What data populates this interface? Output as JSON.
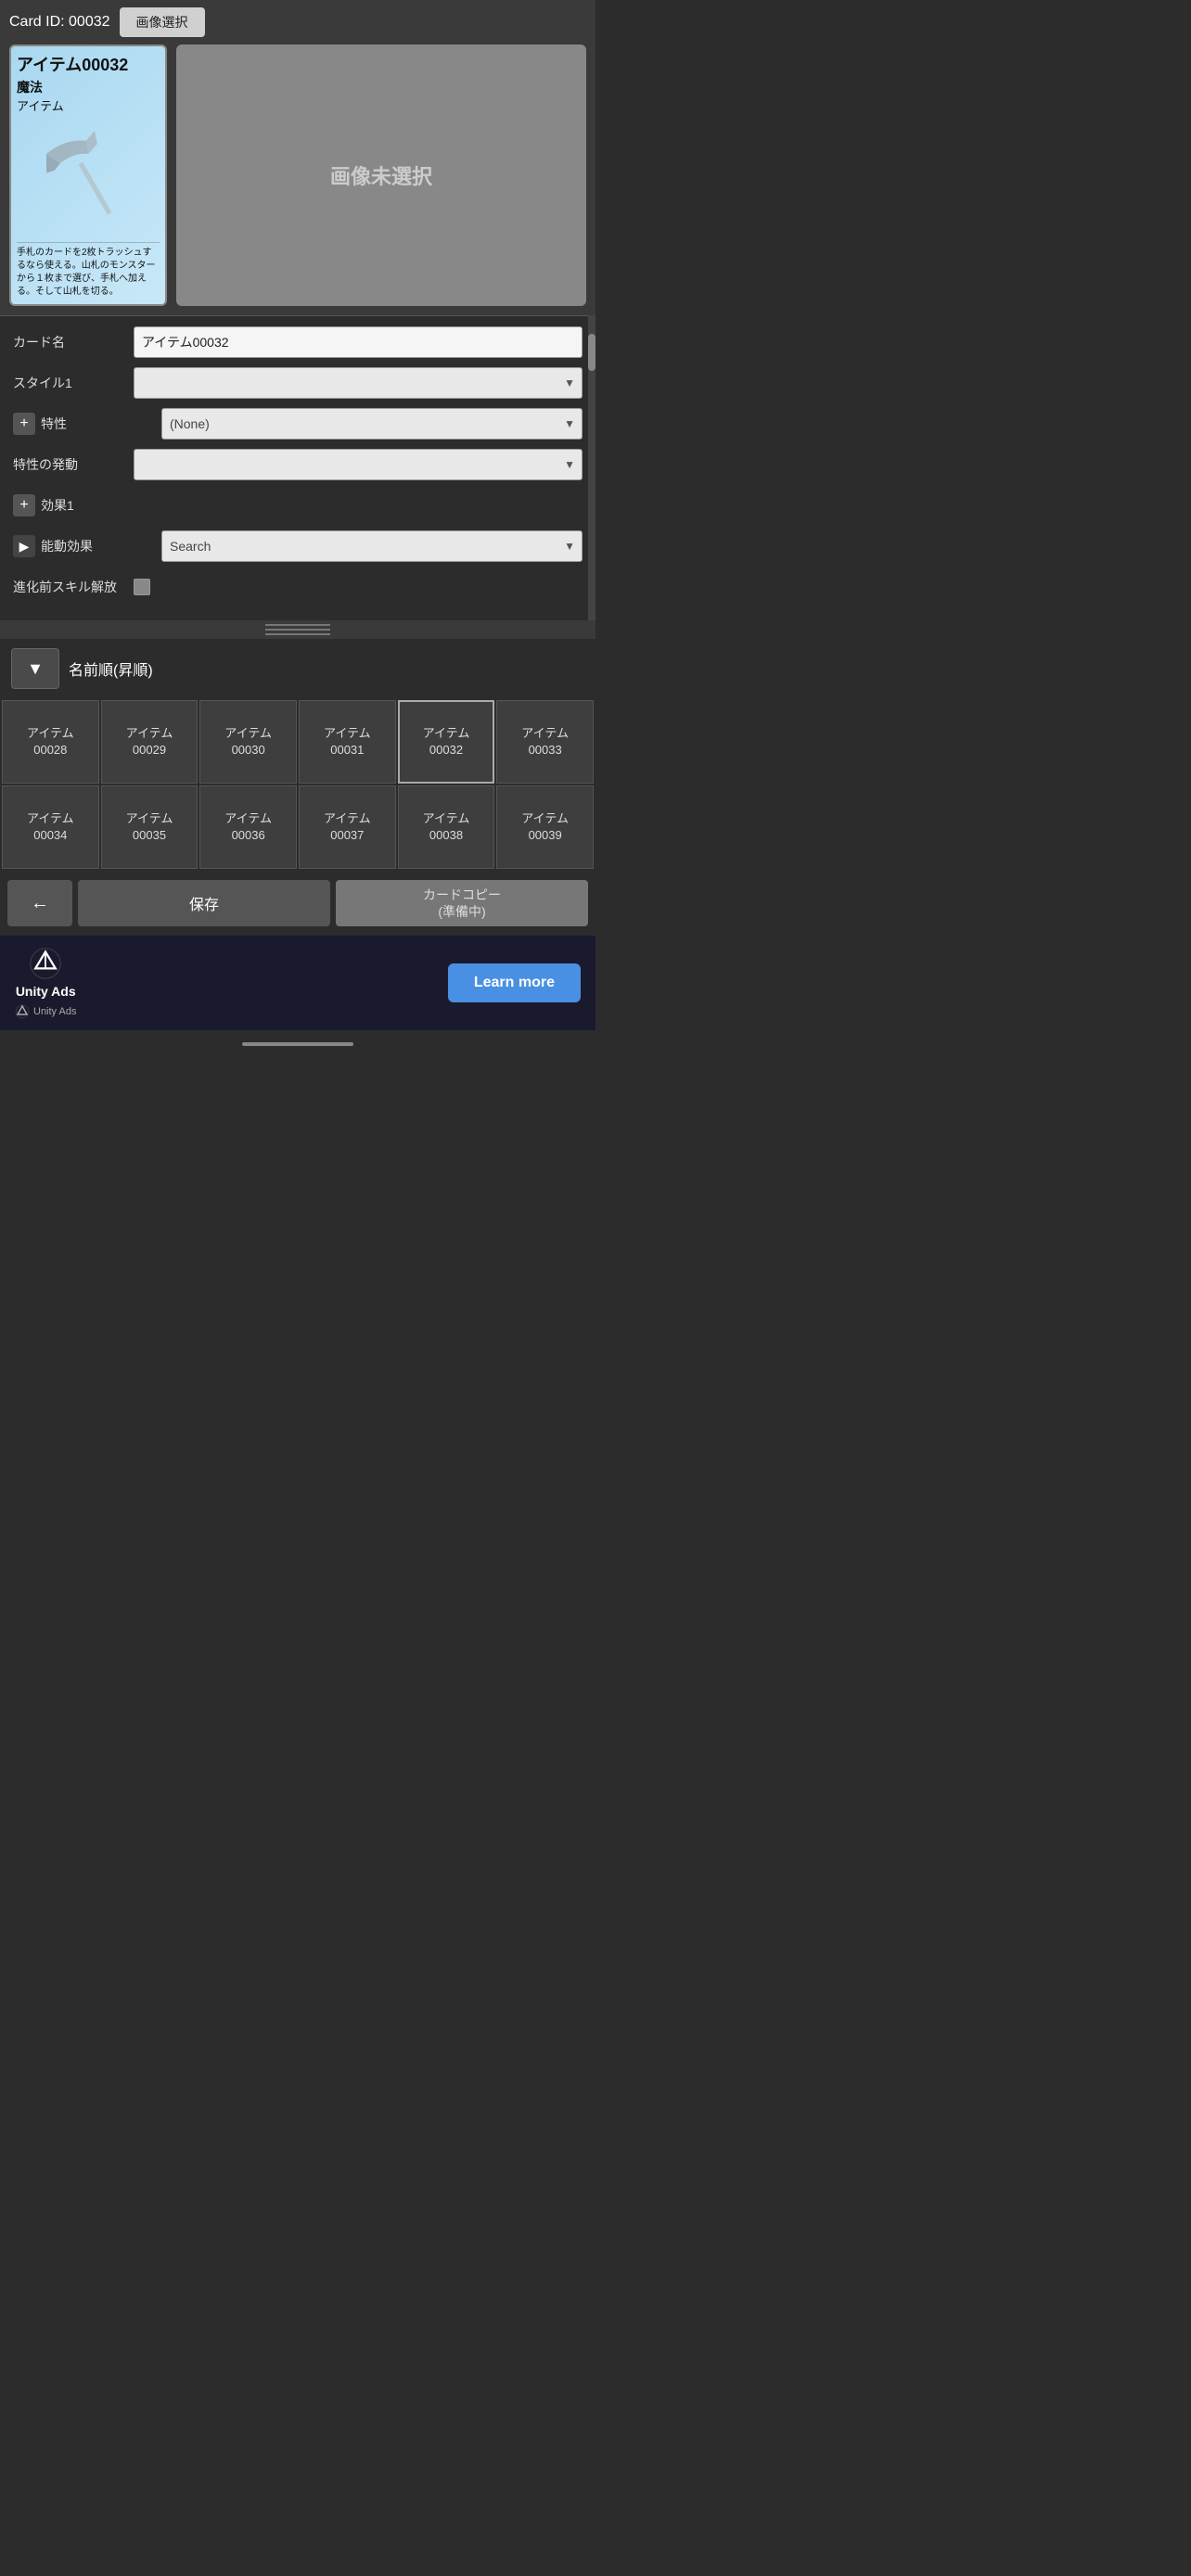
{
  "card": {
    "id_label": "Card ID: 00032",
    "image_select_btn": "画像選択",
    "card_title": "アイテム00032",
    "card_type": "魔法",
    "card_subtype": "アイテム",
    "card_description": "手札のカードを2枚トラッシュするなら使える。山札のモンスターから１枚まで選び、手札へ加える。そして山札を切る。",
    "no_image_text": "画像未選択"
  },
  "form": {
    "card_name_label": "カード名",
    "card_name_value": "アイテム00032",
    "style1_label": "スタイル1",
    "style1_value": "",
    "trait_label": "特性",
    "trait_value": "(None)",
    "trait_trigger_label": "特性の発動",
    "trait_trigger_value": "",
    "effect1_label": "効果1",
    "active_effect_label": "能動効果",
    "active_effect_placeholder": "Search",
    "evolution_label": "進化前スキル解放"
  },
  "sort": {
    "sort_label": "名前順(昇順)",
    "dropdown_arrow": "▼"
  },
  "grid": {
    "items": [
      {
        "label": "アイテム\n00028"
      },
      {
        "label": "アイテム\n00029"
      },
      {
        "label": "アイテム\n00030"
      },
      {
        "label": "アイテム\n00031"
      },
      {
        "label": "アイテム\n00032",
        "active": true
      },
      {
        "label": "アイテム\n00033"
      },
      {
        "label": "アイテム\n00034"
      },
      {
        "label": "アイテム\n00035"
      },
      {
        "label": "アイテム\n00036"
      },
      {
        "label": "アイテム\n00037"
      },
      {
        "label": "アイテム\n00038"
      },
      {
        "label": "アイテム\n00039"
      }
    ]
  },
  "buttons": {
    "back_arrow": "←",
    "save_label": "保存",
    "copy_label": "カードコピー\n(準備中)"
  },
  "ads": {
    "unity_ads_label": "Unity Ads",
    "unity_ads_small": "Unity  Ads",
    "learn_more_label": "Learn more"
  }
}
